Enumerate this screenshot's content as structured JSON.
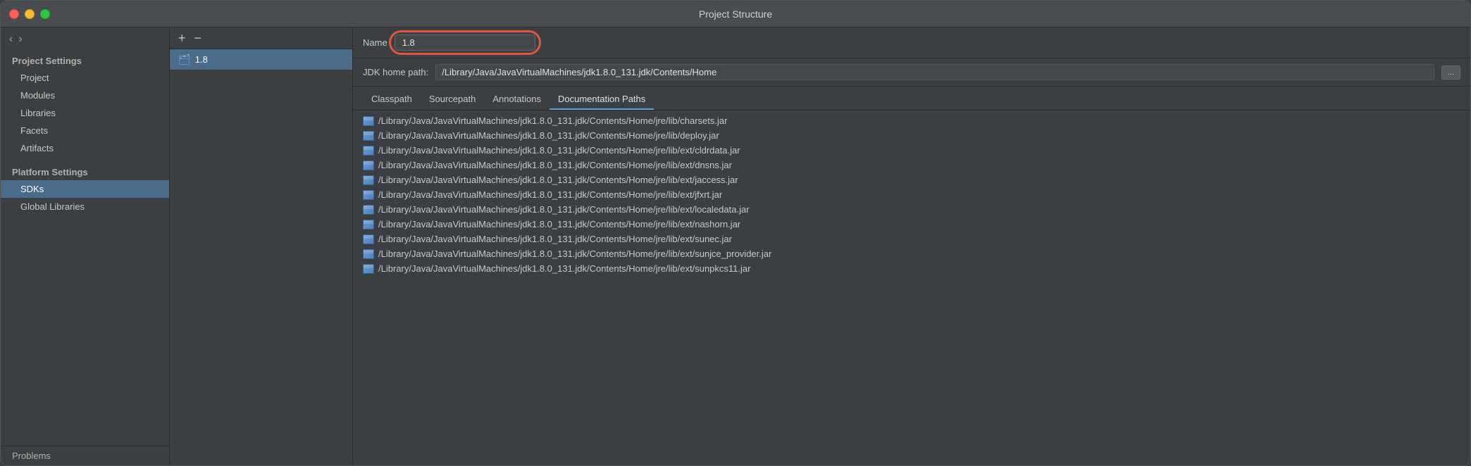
{
  "window": {
    "title": "Project Structure"
  },
  "sidebar": {
    "nav": {
      "back_label": "‹",
      "forward_label": "›"
    },
    "project_settings_label": "Project Settings",
    "items": [
      {
        "id": "project",
        "label": "Project"
      },
      {
        "id": "modules",
        "label": "Modules"
      },
      {
        "id": "libraries",
        "label": "Libraries"
      },
      {
        "id": "facets",
        "label": "Facets"
      },
      {
        "id": "artifacts",
        "label": "Artifacts"
      }
    ],
    "platform_settings_label": "Platform Settings",
    "platform_items": [
      {
        "id": "sdks",
        "label": "SDKs",
        "active": true
      },
      {
        "id": "global-libraries",
        "label": "Global Libraries"
      }
    ],
    "problems_label": "Problems"
  },
  "sdk_panel": {
    "add_btn": "+",
    "remove_btn": "−",
    "sdk_item": {
      "icon": "📁",
      "label": "1.8"
    }
  },
  "detail": {
    "name_label": "Name",
    "name_value": "1.8",
    "jdk_path_label": "JDK home path:",
    "jdk_path_value": "/Library/Java/JavaVirtualMachines/jdk1.8.0_131.jdk/Contents/Home",
    "jdk_path_btn": "...",
    "tabs": [
      {
        "id": "classpath",
        "label": "Classpath",
        "active": false
      },
      {
        "id": "sourcepath",
        "label": "Sourcepath",
        "active": false
      },
      {
        "id": "annotations",
        "label": "Annotations",
        "active": false
      },
      {
        "id": "documentation-paths",
        "label": "Documentation Paths",
        "active": true
      }
    ],
    "classpath_items": [
      "/Library/Java/JavaVirtualMachines/jdk1.8.0_131.jdk/Contents/Home/jre/lib/charsets.jar",
      "/Library/Java/JavaVirtualMachines/jdk1.8.0_131.jdk/Contents/Home/jre/lib/deploy.jar",
      "/Library/Java/JavaVirtualMachines/jdk1.8.0_131.jdk/Contents/Home/jre/lib/ext/cldrdata.jar",
      "/Library/Java/JavaVirtualMachines/jdk1.8.0_131.jdk/Contents/Home/jre/lib/ext/dnsns.jar",
      "/Library/Java/JavaVirtualMachines/jdk1.8.0_131.jdk/Contents/Home/jre/lib/ext/jaccess.jar",
      "/Library/Java/JavaVirtualMachines/jdk1.8.0_131.jdk/Contents/Home/jre/lib/ext/jfxrt.jar",
      "/Library/Java/JavaVirtualMachines/jdk1.8.0_131.jdk/Contents/Home/jre/lib/ext/localedata.jar",
      "/Library/Java/JavaVirtualMachines/jdk1.8.0_131.jdk/Contents/Home/jre/lib/ext/nashorn.jar",
      "/Library/Java/JavaVirtualMachines/jdk1.8.0_131.jdk/Contents/Home/jre/lib/ext/sunec.jar",
      "/Library/Java/JavaVirtualMachines/jdk1.8.0_131.jdk/Contents/Home/jre/lib/ext/sunjce_provider.jar",
      "/Library/Java/JavaVirtualMachines/jdk1.8.0_131.jdk/Contents/Home/jre/lib/ext/sunpkcs11.jar"
    ]
  }
}
